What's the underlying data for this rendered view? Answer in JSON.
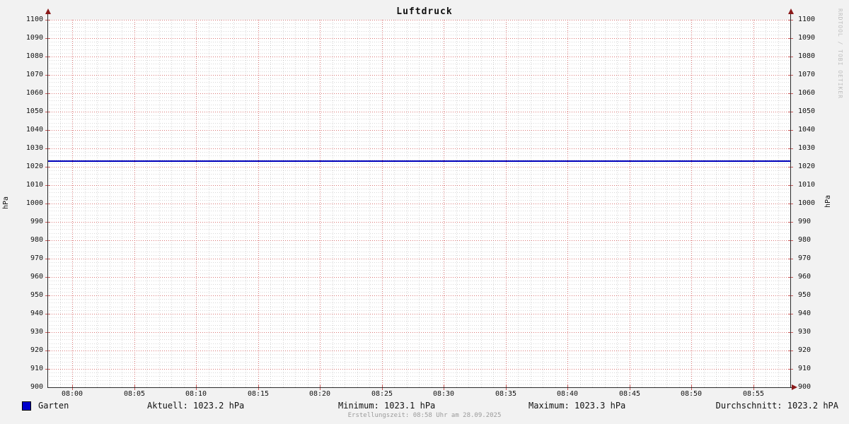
{
  "title": "Luftdruck",
  "watermark": "RRDTOOL / TOBI OETIKER",
  "axis": {
    "y_label_left": "hPa",
    "y_label_right": "hPa"
  },
  "chart_data": {
    "type": "line",
    "title": "Luftdruck",
    "ylabel": "hPa",
    "ylabel_right": "hPa",
    "ylim": [
      900,
      1100
    ],
    "y_major_step": 10,
    "y_minor_step": 2,
    "x_start": "07:58",
    "x_end": "08:58",
    "x_total_minutes": 60,
    "x_major_step_min": 5,
    "x_minor_step_min": 1,
    "x_first_major_offset_min": 2,
    "x_tick_labels": [
      "08:00",
      "08:05",
      "08:10",
      "08:15",
      "08:20",
      "08:25",
      "08:30",
      "08:35",
      "08:40",
      "08:45",
      "08:50",
      "08:55"
    ],
    "grid": true,
    "legend_position": "bottom",
    "series": [
      {
        "name": "Garten",
        "color": "#0000bb",
        "shape": "flat-line",
        "value": 1023.2,
        "stats": {
          "current": 1023.2,
          "min": 1023.1,
          "max": 1023.3,
          "avg": 1023.2,
          "unit": "hPa"
        }
      }
    ]
  },
  "legend": {
    "series_label": "Garten",
    "current": "Aktuell: 1023.2 hPa",
    "minimum": "Minimum: 1023.1 hPa",
    "maximum": "Maximum: 1023.3 hPa",
    "average": "Durchschnitt: 1023.2 hPA"
  },
  "footer": "Erstellungszeit: 08:58 Uhr am 28.09.2025",
  "colors": {
    "background": "#f2f2f2",
    "canvas": "#ffffff",
    "major_grid": "#cc4646",
    "minor_grid": "#6e6e6e",
    "axis": "#2b2b2b",
    "arrow": "#8b1a1a",
    "line": "#0000bb",
    "legend_swatch": "#0000cc",
    "watermark": "#bfbfbf"
  }
}
